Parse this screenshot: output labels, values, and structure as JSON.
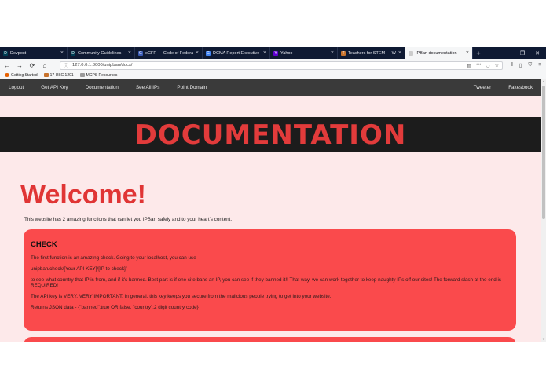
{
  "browser": {
    "tabs": [
      {
        "label": "Devpost",
        "icon": "devpost-icon",
        "color": "#003e54",
        "glyph": "D"
      },
      {
        "label": "Community Guidelines",
        "icon": "devpost-icon",
        "color": "#003e54",
        "glyph": "D"
      },
      {
        "label": "eCFR — Code of Federal R",
        "icon": "gpo-icon",
        "color": "#3b5bb5",
        "glyph": "G"
      },
      {
        "label": "DCMA Report Executive S",
        "icon": "google-icon",
        "color": "#4285f4",
        "glyph": "G"
      },
      {
        "label": "Yahoo",
        "icon": "yahoo-icon",
        "color": "#6001d2",
        "glyph": "Y"
      },
      {
        "label": "Teachers for STEM — Wa",
        "icon": "teachers-icon",
        "color": "#c8732d",
        "glyph": "T"
      },
      {
        "label": "IPBan documentation",
        "icon": "page-icon",
        "color": "#cccccc",
        "glyph": ""
      }
    ],
    "active_tab": 6,
    "new_tab_glyph": "+",
    "url": "127.0.0.1:8000/unipban/docs/",
    "bookmarks": [
      {
        "label": "Getting Started",
        "icon": "firefox-icon",
        "color": "#e66000"
      },
      {
        "label": "17 USC 1201",
        "icon": "bookmark-icon",
        "color": "#c8732d"
      },
      {
        "label": "MCPS Resources",
        "icon": "folder-icon",
        "color": "#9a9a9a"
      }
    ]
  },
  "site": {
    "nav_left": [
      "Logout",
      "Get API Key",
      "Documentation",
      "See All IPs",
      "Point Domain"
    ],
    "nav_right": [
      "Tweeter",
      "Fakesbook"
    ],
    "banner_title": "DOCUMENTATION",
    "welcome": "Welcome!",
    "intro": "This website has 2 amazing functions that can let you IPBan safely and to your heart's content.",
    "check_card": {
      "title": "CHECK",
      "paragraphs": [
        "The first function is an amazing check. Going to your localhost, you can use",
        "unipban/check/[Your API KEY]/[IP to check]/",
        "to see what country that IP is from, and if it's banned. Best part is if one site bans an IP, you can see if they banned it!! That way, we can work together to keep naughty IPs off our sites! The forward slash at the end is REQUIRED!",
        "The API key is VERY, VERY IMPORTANT. In general, this key keeps you secure from the malicious people trying to get into your website.",
        "Returns JSON data - {\"banned\":true OR false, \"country\":2 digit country code}"
      ]
    }
  },
  "colors": {
    "accent_red": "#e23b3b",
    "card_red": "#fa4a4c",
    "page_bg": "#fde9ea",
    "nav_bg": "#3a3a3a",
    "banner_bg": "#1c1c1c"
  }
}
